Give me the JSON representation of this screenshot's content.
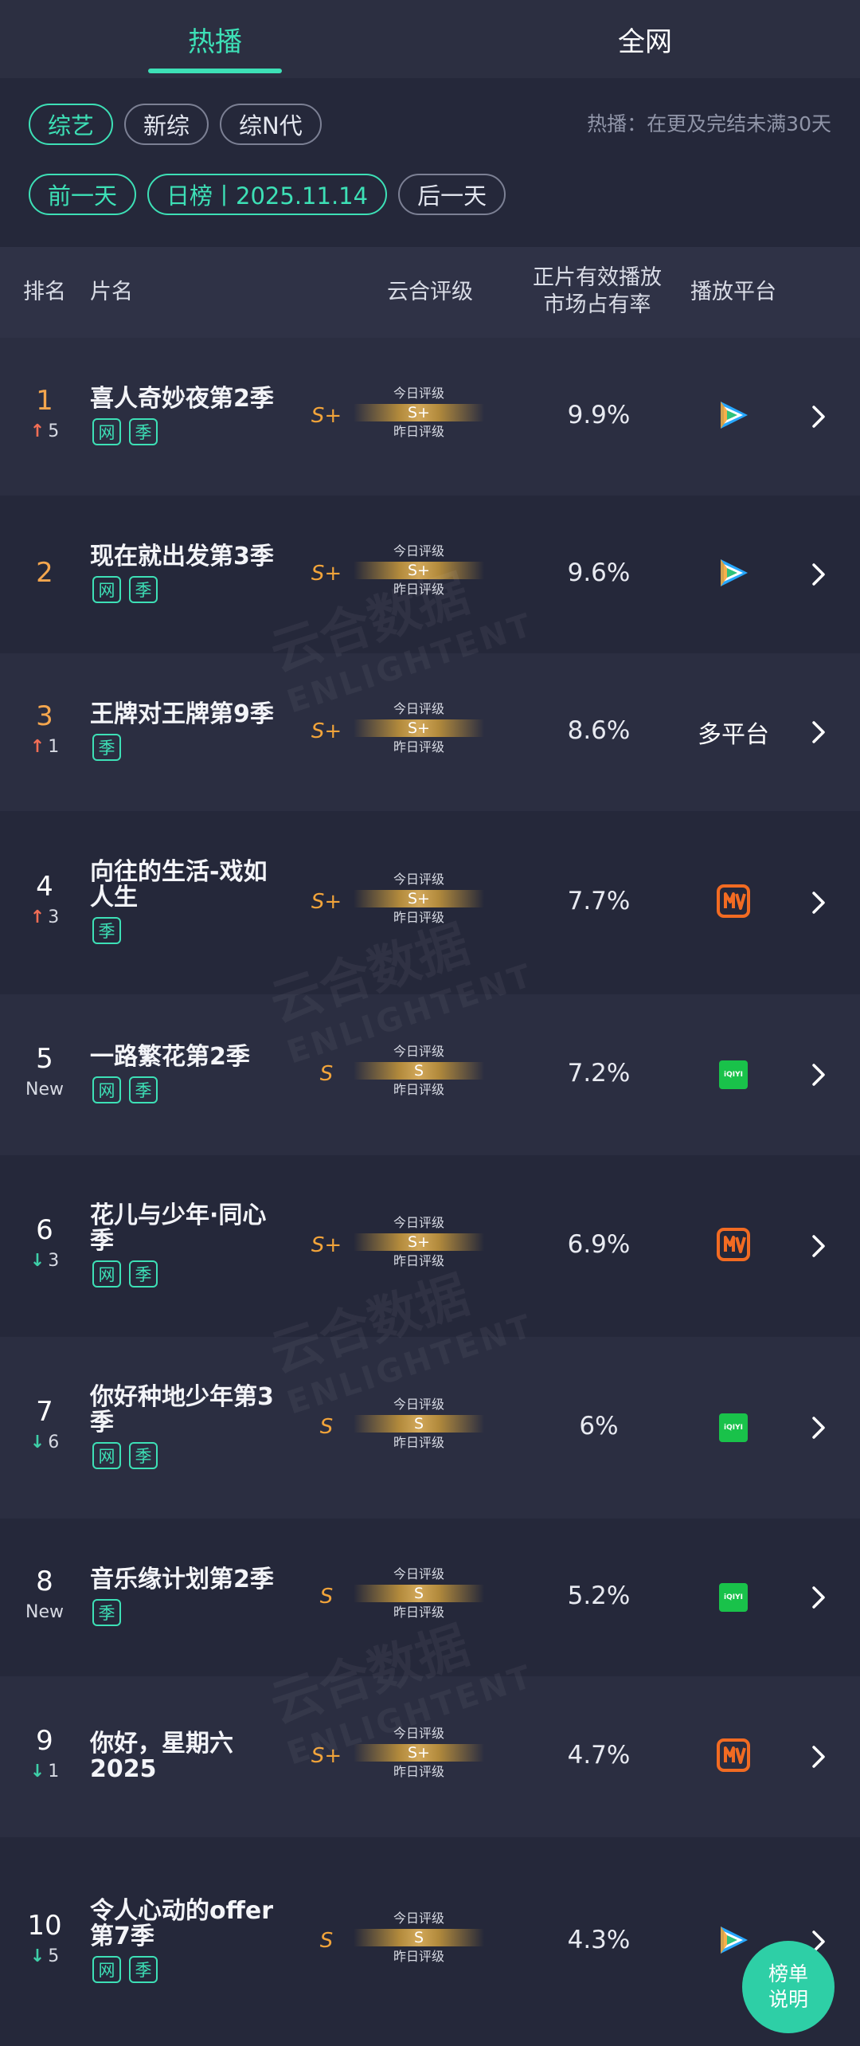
{
  "tabs": [
    {
      "label": "热播",
      "active": true
    },
    {
      "label": "全网",
      "active": false
    }
  ],
  "filters": {
    "chips": [
      "综艺",
      "新综",
      "综N代"
    ],
    "hint": "热播：在更及完结未满30天"
  },
  "date_nav": {
    "prev": "前一天",
    "current": "日榜丨2025.11.14",
    "next": "后一天"
  },
  "table_header": {
    "rank": "排名",
    "name": "片名",
    "rating": "云合评级",
    "share_line1": "正片有效播放",
    "share_line2": "市场占有率",
    "platform": "播放平台"
  },
  "rating_labels": {
    "today": "今日评级",
    "yesterday": "昨日评级"
  },
  "watermark": {
    "cn": "云合数据",
    "en": "ENLIGHTENT"
  },
  "rows": [
    {
      "rank": "1",
      "trend": "up",
      "change": "5",
      "title_lines": [
        "喜人奇妙夜第2季"
      ],
      "tags": [
        "网",
        "季"
      ],
      "grade_yesterday": "S+",
      "grade_today": "S+",
      "share": "9.9%",
      "platform": "tencent"
    },
    {
      "rank": "2",
      "trend": "",
      "change": "",
      "title_lines": [
        "现在就出发第3季"
      ],
      "tags": [
        "网",
        "季"
      ],
      "grade_yesterday": "S+",
      "grade_today": "S+",
      "share": "9.6%",
      "platform": "tencent"
    },
    {
      "rank": "3",
      "trend": "up",
      "change": "1",
      "title_lines": [
        "王牌对王牌第9季"
      ],
      "tags": [
        "季"
      ],
      "grade_yesterday": "S+",
      "grade_today": "S+",
      "share": "8.6%",
      "platform": "多平台"
    },
    {
      "rank": "4",
      "trend": "up",
      "change": "3",
      "title_lines": [
        "向往的生活-戏如",
        "人生"
      ],
      "tags": [
        "季"
      ],
      "grade_yesterday": "S+",
      "grade_today": "S+",
      "share": "7.7%",
      "platform": "mango"
    },
    {
      "rank": "5",
      "trend": "new",
      "change": "New",
      "title_lines": [
        "一路繁花第2季"
      ],
      "tags": [
        "网",
        "季"
      ],
      "grade_yesterday": "S",
      "grade_today": "S",
      "share": "7.2%",
      "platform": "iqiyi"
    },
    {
      "rank": "6",
      "trend": "down",
      "change": "3",
      "title_lines": [
        "花儿与少年·同心",
        "季"
      ],
      "tags": [
        "网",
        "季"
      ],
      "grade_yesterday": "S+",
      "grade_today": "S+",
      "share": "6.9%",
      "platform": "mango"
    },
    {
      "rank": "7",
      "trend": "down",
      "change": "6",
      "title_lines": [
        "你好种地少年第3",
        "季"
      ],
      "tags": [
        "网",
        "季"
      ],
      "grade_yesterday": "S",
      "grade_today": "S",
      "share": "6%",
      "platform": "iqiyi"
    },
    {
      "rank": "8",
      "trend": "new",
      "change": "New",
      "title_lines": [
        "音乐缘计划第2季"
      ],
      "tags": [
        "季"
      ],
      "grade_yesterday": "S",
      "grade_today": "S",
      "share": "5.2%",
      "platform": "iqiyi"
    },
    {
      "rank": "9",
      "trend": "down",
      "change": "1",
      "title_lines": [
        "你好，星期六",
        "2025"
      ],
      "tags": [],
      "grade_yesterday": "S+",
      "grade_today": "S+",
      "share": "4.7%",
      "platform": "mango"
    },
    {
      "rank": "10",
      "trend": "down",
      "change": "5",
      "title_lines": [
        "令人心动的offer",
        "第7季"
      ],
      "tags": [
        "网",
        "季"
      ],
      "grade_yesterday": "S",
      "grade_today": "S",
      "share": "4.3%",
      "platform": "tencent"
    }
  ],
  "platform_icons": {
    "tencent": "tencent-video-icon",
    "mango": "mango-tv-icon",
    "iqiyi": "iqiyi-icon"
  },
  "iqiyi_text": "iQIYI",
  "fab": {
    "line1": "榜单",
    "line2": "说明"
  },
  "colors": {
    "accent": "#3de0b6",
    "gold": "#f2a43a",
    "up": "#f36e55",
    "down": "#3ecfa8",
    "background": "#25283a"
  }
}
